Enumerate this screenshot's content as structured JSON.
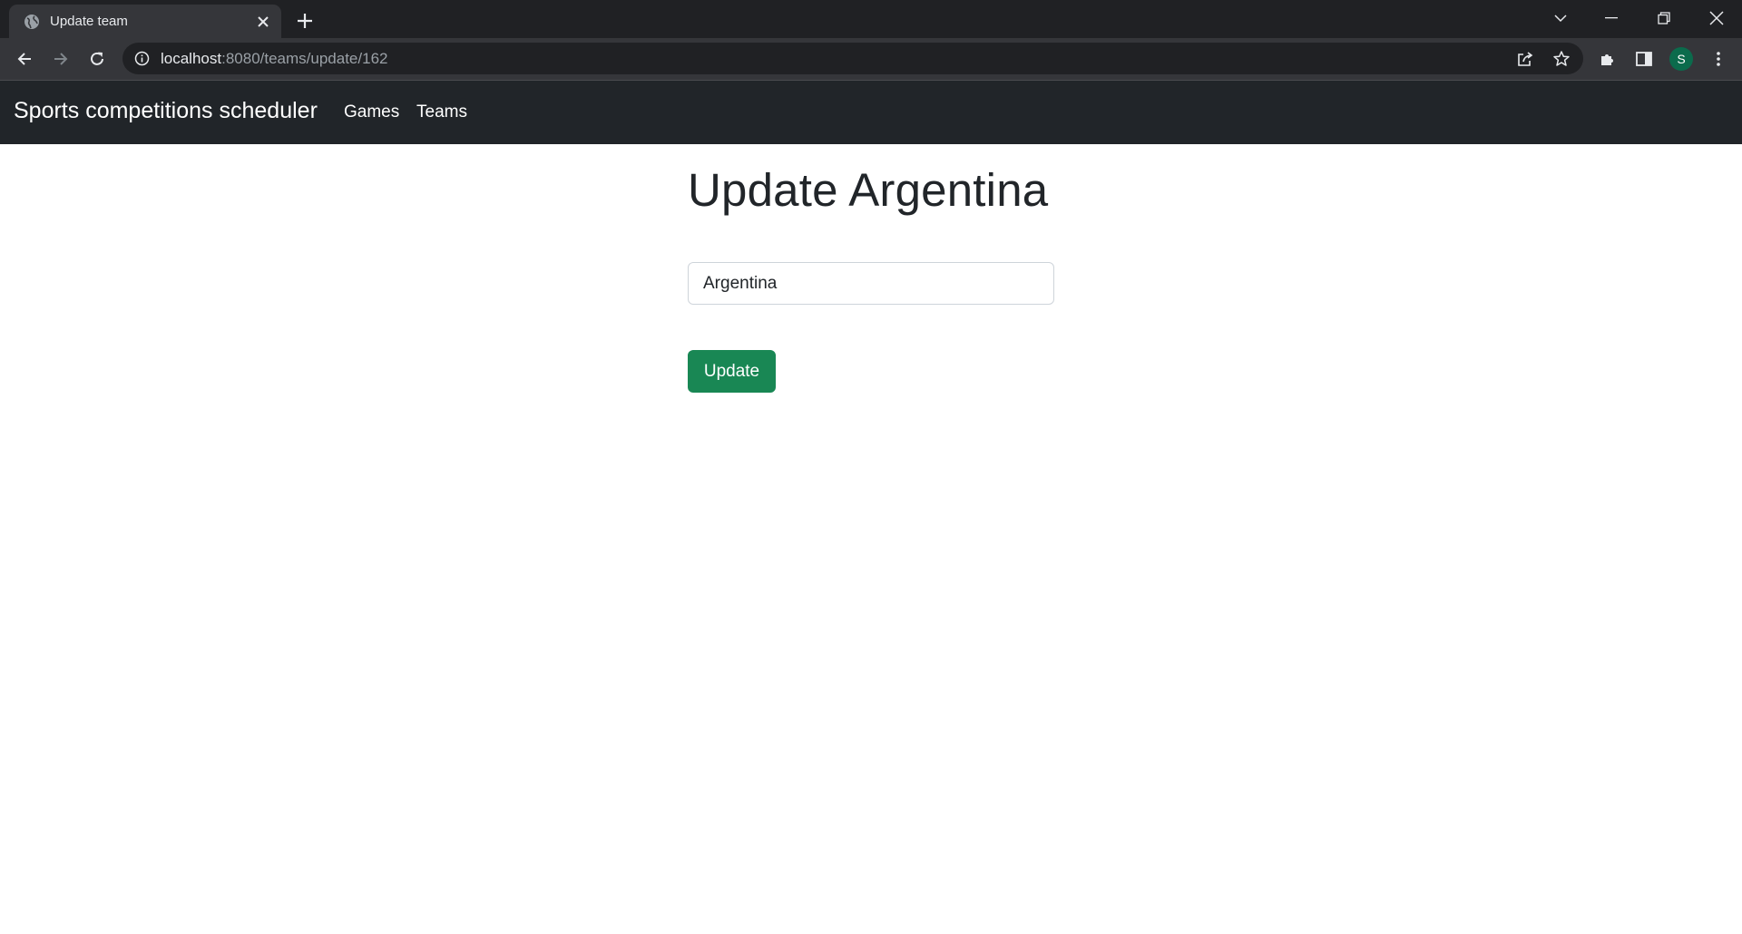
{
  "browser": {
    "tab": {
      "title": "Update team",
      "favicon": "globe-icon"
    },
    "address_bar": {
      "host": "localhost",
      "path": ":8080/teams/update/162"
    },
    "profile_initial": "S",
    "profile_color": "#0b6b4c"
  },
  "navbar": {
    "brand": "Sports competitions scheduler",
    "links": [
      {
        "label": "Games"
      },
      {
        "label": "Teams"
      }
    ],
    "background": "#212529"
  },
  "main": {
    "title": "Update Argentina",
    "name_field": {
      "value": "Argentina"
    },
    "submit_label": "Update",
    "accent_color": "#198754"
  }
}
